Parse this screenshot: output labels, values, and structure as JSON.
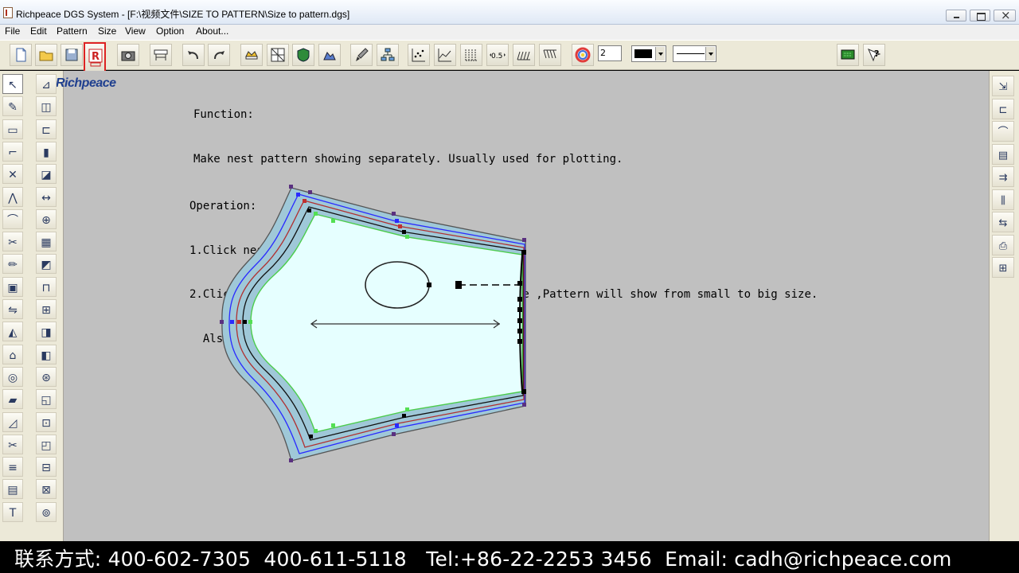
{
  "window": {
    "title": "Richpeace DGS System - [F:\\视频文件\\SIZE TO PATTERN\\Size to pattern.dgs]"
  },
  "menu": [
    "File",
    "Edit",
    "Pattern",
    "Size",
    "View",
    "Option",
    "About..."
  ],
  "toolbar": {
    "number_value": "2",
    "line_color": "#000000",
    "step_label": "0.5"
  },
  "canvas": {
    "logo": "Richpeace",
    "instructions": [
      "Function:",
      "Make nest pattern showing separately. Usually used for plotting.",
      "Operation:",
      "1.Click nest pattern;",
      "2.Click 【Edit】→【size to pattern】,Select all size ,Pattern will show from small to big size.",
      "  Also you can select size which you need ."
    ],
    "pattern_fill": "#e6ffff",
    "canvas_bg": "#c0c0c0"
  },
  "footer": {
    "contact": "联系方式: 400-602-7305  400-611-5118   Tel:+86-22-2253 3456  Email: cadh@richpeace.com"
  }
}
